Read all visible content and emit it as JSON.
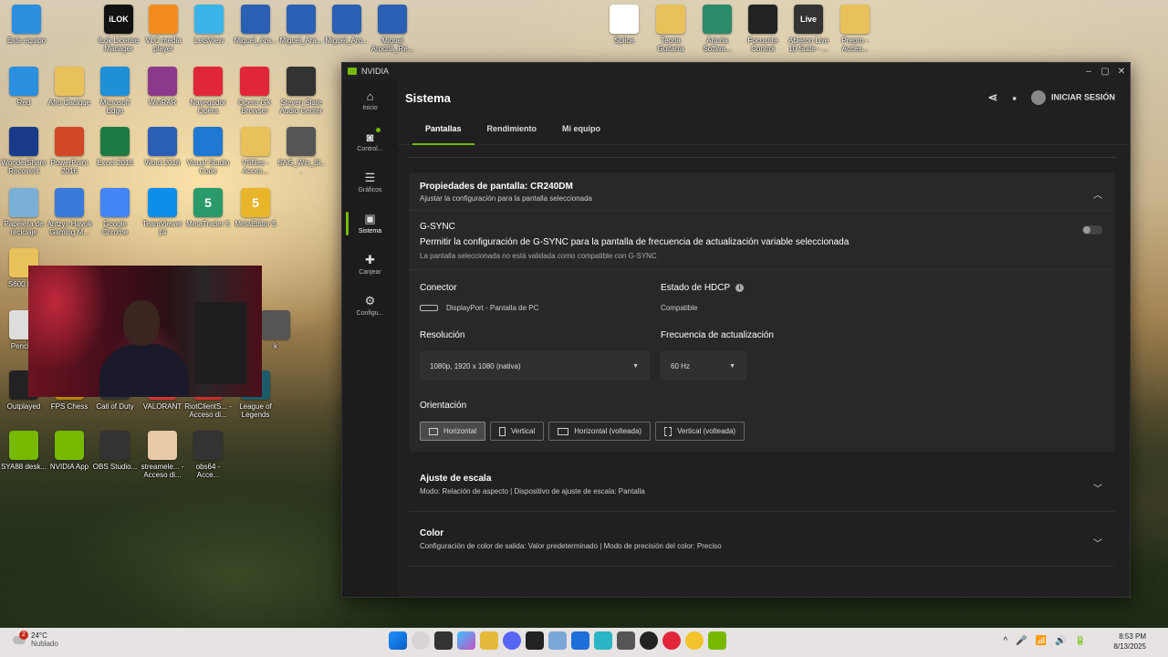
{
  "desktop": {
    "icons": [
      {
        "label": "Este equipo"
      },
      {
        "label": "iLok License Manager",
        "glyph": "iLOK"
      },
      {
        "label": "VLC media player"
      },
      {
        "label": "LetsView"
      },
      {
        "label": "Miguel_Ara..."
      },
      {
        "label": "Miguel_Ara..."
      },
      {
        "label": "Miguel_Aro..."
      },
      {
        "label": "Miguel Arocha_Re..."
      },
      {
        "label": "Splice"
      },
      {
        "label": "Teoria Guitarra"
      },
      {
        "label": "Arturia Softwa..."
      },
      {
        "label": "Focusrite Control"
      },
      {
        "label": "Ableton Live 10 Suite - ...",
        "glyph": "Live"
      },
      {
        "label": "Prepro - Acces..."
      },
      {
        "label": "Red"
      },
      {
        "label": "Afro Cacique"
      },
      {
        "label": "Microsoft Edge"
      },
      {
        "label": "WinRAR"
      },
      {
        "label": "Navegador Opera"
      },
      {
        "label": "Opera GX Browser"
      },
      {
        "label": "Steven Slate Audio Center"
      },
      {
        "label": "WonderShare Recoverit"
      },
      {
        "label": "PowerPoint 2016"
      },
      {
        "label": "Excel 2016"
      },
      {
        "label": "Word 2016"
      },
      {
        "label": "Visual Studio Code"
      },
      {
        "label": "VSfiles - Acces..."
      },
      {
        "label": "SAG_Win_Si..."
      },
      {
        "label": "Papelera de reciclaje"
      },
      {
        "label": "Antzyx Havok Gaming M..."
      },
      {
        "label": "Google Chrome"
      },
      {
        "label": "TeamViewer 14"
      },
      {
        "label": "MetaTrader 5",
        "glyph": "5"
      },
      {
        "label": "MetaEditor 5",
        "glyph": "5"
      },
      {
        "label": "S600 M..."
      },
      {
        "label": "Pencles"
      },
      {
        "label": "Outplayed"
      },
      {
        "label": "FPS Chess"
      },
      {
        "label": "Call of Duty"
      },
      {
        "label": "VALORANT"
      },
      {
        "label": "RiotClientS... - Acceso di..."
      },
      {
        "label": "League of Legends"
      },
      {
        "label": "SYA88 desk..."
      },
      {
        "label": "NVIDIA App"
      },
      {
        "label": "OBS Studio..."
      },
      {
        "label": "streamele... - Acceso di..."
      },
      {
        "label": "obs64 - Acce..."
      },
      {
        "label": "k"
      }
    ]
  },
  "window": {
    "app_name": "NVIDIA",
    "controls": {
      "minimize": "–",
      "maximize": "▢",
      "close": "✕"
    }
  },
  "rail": {
    "items": [
      {
        "label": "Inicio",
        "icon": "home-icon",
        "glyph": "⌂"
      },
      {
        "label": "Control...",
        "icon": "controller-icon",
        "glyph": "◙"
      },
      {
        "label": "Gráficos",
        "icon": "sliders-icon",
        "glyph": "☰"
      },
      {
        "label": "Sistema",
        "icon": "system-icon",
        "glyph": "▣"
      },
      {
        "label": "Canjear",
        "icon": "gift-icon",
        "glyph": "✚"
      },
      {
        "label": "Configu...",
        "icon": "gear-icon",
        "glyph": "⚙"
      }
    ]
  },
  "header": {
    "title": "Sistema",
    "share_glyph": "⋖",
    "feedback_glyph": "▪",
    "login_label": "INICIAR SESIÓN"
  },
  "tabs": [
    {
      "label": "Pantallas"
    },
    {
      "label": "Rendimiento"
    },
    {
      "label": "Mi equipo"
    }
  ],
  "display_props": {
    "title": "Propiedades de pantalla: CR240DM",
    "subtitle": "Ajustar la configuración para la pantalla seleccionada",
    "gsync": {
      "label": "G-SYNC",
      "description": "Permitir la configuración de G-SYNC para la pantalla de frecuencia de actualización variable seleccionada",
      "note": "La pantalla seleccionada no está validada como compatible con G-SYNC",
      "enabled": false
    },
    "connector": {
      "label": "Conector",
      "value": "DisplayPort - Pantalla de PC"
    },
    "hdcp": {
      "label": "Estado de HDCP",
      "value": "Compatible",
      "info_glyph": "i"
    },
    "resolution": {
      "label": "Resolución",
      "value": "1080p, 1920 x 1080 (nativa)"
    },
    "refresh": {
      "label": "Frecuencia de actualización",
      "value": "60 Hz"
    },
    "orientation": {
      "label": "Orientación",
      "options": [
        {
          "label": "Horizontal"
        },
        {
          "label": "Vertical"
        },
        {
          "label": "Horizontal (volteada)"
        },
        {
          "label": "Vertical (volteada)"
        }
      ],
      "selected": "Horizontal"
    }
  },
  "scaling": {
    "title": "Ajuste de escala",
    "summary": "Modo: Relación de aspecto | Dispositivo de ajuste de escala: Pantalla"
  },
  "color": {
    "title": "Color",
    "summary": "Configuración de color de salida: Valor predeterminado | Modo de precisión del color: Preciso"
  },
  "taskbar": {
    "weather_temp": "24°C",
    "weather_desc": "Nublado",
    "notification_count": "2",
    "time": "8:53 PM",
    "date": "8/13/2025",
    "tray_glyphs": [
      "^",
      "🎤",
      "📶",
      "🔊",
      "🔋"
    ]
  }
}
